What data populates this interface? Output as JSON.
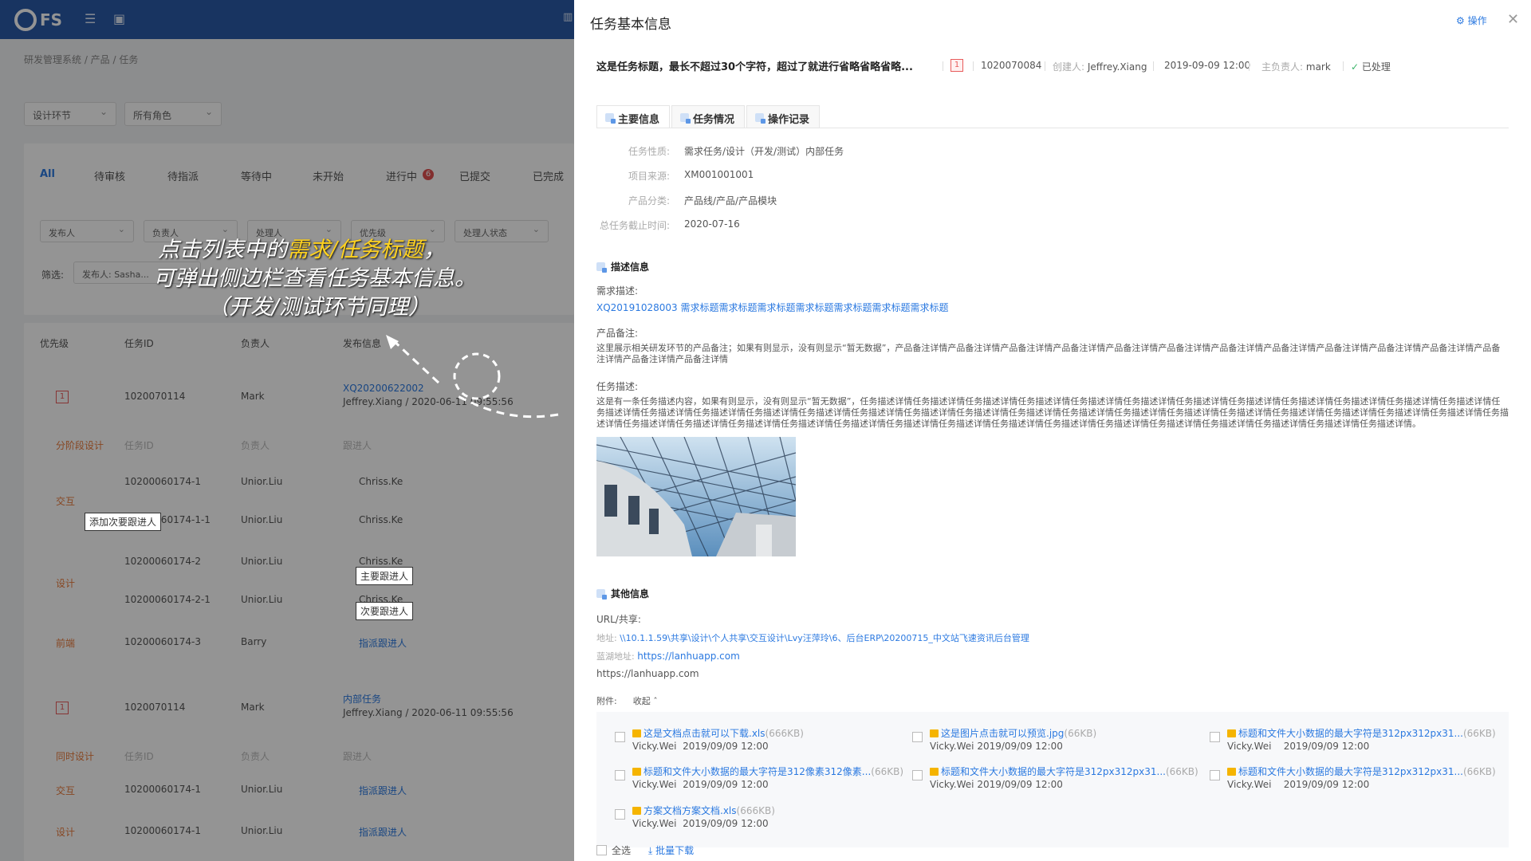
{
  "app": {
    "logo": "FS"
  },
  "breadcrumb": "研发管理系统 / 产品 / 任务",
  "filters": {
    "stage": "设计环节",
    "role": "所有角色"
  },
  "bg_tabs": [
    "All",
    "待审核",
    "待指派",
    "等待中",
    "未开始",
    "进行中",
    "已提交",
    "已完成"
  ],
  "bg_tab_badge": "6",
  "bg_selects": [
    "发布人",
    "负责人",
    "处理人",
    "优先级",
    "处理人状态"
  ],
  "bg_filter": {
    "label": "筛选:",
    "value": "发布人: Sasha..."
  },
  "bg_cols": [
    "优先级",
    "任务ID",
    "负责人",
    "发布信息"
  ],
  "bg_rows": [
    {
      "id": "1020070114",
      "owner": "Mark",
      "link": "XQ20200622002",
      "info": "Jeffrey.Xiang / 2020-06-11 09:55:56"
    },
    {
      "id": "1020070114",
      "owner": "Mark",
      "link": "内部任务",
      "info": "Jeffrey.Xiang / 2020-06-11 09:55:56"
    }
  ],
  "bg_sub1": [
    {
      "stage": "分阶段设计",
      "id": "任务ID",
      "owner": "负责人",
      "handler": "跟进人"
    },
    {
      "stage": "",
      "id": "10200060174-1",
      "owner": "Unior.Liu",
      "handler": "Chriss.Ke"
    },
    {
      "stage": "交互",
      "id": "10200060174-1-1",
      "owner": "Unior.Liu",
      "handler": "Chriss.Ke"
    },
    {
      "stage": "",
      "id": "10200060174-2",
      "owner": "Unior.Liu",
      "handler": "Chriss.Ke"
    },
    {
      "stage": "设计",
      "id": "10200060174-2-1",
      "owner": "Unior.Liu",
      "handler": "Chriss.Ke"
    },
    {
      "stage": "前端",
      "id": "10200060174-3",
      "owner": "Barry",
      "handler": "指派跟进人"
    }
  ],
  "bg_sub2": [
    {
      "stage": "同时设计",
      "id": "任务ID",
      "owner": "负责人",
      "handler": "跟进人"
    },
    {
      "stage": "交互",
      "id": "10200060174-1",
      "owner": "Unior.Liu",
      "handler": "指派跟进人"
    },
    {
      "stage": "设计",
      "id": "10200060174-1",
      "owner": "Unior.Liu",
      "handler": "指派跟进人"
    }
  ],
  "bg_priority": "1",
  "tooltips": {
    "add_secondary": "添加次要跟进人",
    "main_follow": "主要跟进人",
    "secondary_follow": "次要跟进人"
  },
  "annotation": {
    "line1_pre": "点击列表中的",
    "line1_hl": "需求/任务标题",
    "line1_post": "，",
    "line2": "可弹出侧边栏查看任务基本信息。",
    "line3": "（开发/测试环节同理）"
  },
  "panel": {
    "title": "任务基本信息",
    "op_label": "操作",
    "headline": "这是任务标题，最长不超过30个字符，超过了就进行省略省略省略...",
    "priority": "1",
    "task_id": "1020070084",
    "creator_label": "创建人:",
    "creator": "Jeffrey.Xiang",
    "created": "2019-09-09 12:00",
    "owner_label": "主负责人:",
    "owner": "mark",
    "status": "已处理",
    "tabs": [
      "主要信息",
      "任务情况",
      "操作记录"
    ],
    "fields": [
      {
        "label": "任务性质:",
        "value": "需求任务/设计（开发/测试）内部任务"
      },
      {
        "label": "项目来源:",
        "value": "XM001001001"
      },
      {
        "label": "产品分类:",
        "value": "产品线/产品/产品模块"
      },
      {
        "label": "总任务截止时间:",
        "value": "2020-07-16"
      }
    ],
    "desc_title": "描述信息",
    "req_label": "需求描述:",
    "req_link": "XQ20191028003 需求标题需求标题需求标题需求标题需求标题需求标题需求标题",
    "prod_label": "产品备注:",
    "prod_text": "这里展示相关研发环节的产品备注；如果有则显示，没有则显示“暂无数据”，产品备注详情产品备注详情产品备注详情产品备注详情产品备注详情产品备注详情产品备注详情产品备注详情产品备注详情产品备注详情产品备注详情产品备注详情产品备注详情产品备注详情",
    "task_label": "任务描述:",
    "task_text": "这是有一条任务描述内容，如果有则显示，没有则显示“暂无数据”，任务描述详情任务描述详情任务描述详情任务描述详情任务描述详情任务描述详情任务描述详情任务描述详情任务描述详情任务描述详情任务描述详情任务描述详情任务描述详情任务描述详情任务描述详情任务描述详情任务描述详情任务描述详情任务描述详情任务描述详情任务描述详情任务描述详情任务描述详情任务描述详情任务描述详情任务描述详情任务描述详情任务描述详情任务描述详情任务描述详情任务描述详情任务描述详情任务描述详情任务描述详情任务描述详情任务描述详情任务描述详情任务描述详情任务描述详情任务描述详情任务描述详情任务描述详情任务描述详情任务描述详情任务描述详情。",
    "other_title": "其他信息",
    "url_label": "URL/共享:",
    "addr_label": "地址:",
    "addr": "\\\\10.1.1.59\\共享\\设计\\个人共享\\交互设计\\Lvy汪萍玲\\6、后台ERP\\20200715_中文站飞速资讯后台管理",
    "lanhu_label": "蓝湖地址:",
    "lanhu": "https://lanhuapp.com",
    "url2": "https://lanhuapp.com",
    "att_label": "附件:",
    "collapse": "收起",
    "attachments": [
      {
        "name": "这是文档点击就可以下载.xls",
        "size": "(666KB)",
        "user": "Vicky.Wei",
        "date": "2019/09/09 12:00"
      },
      {
        "name": "这是图片点击就可以预览.jpg",
        "size": "(66KB)",
        "user": "Vicky.Wei",
        "date": "2019/09/09 12:00"
      },
      {
        "name": "标题和文件大小数据的最大字符是312px312px31...",
        "size": "(66KB)",
        "user": "Vicky.Wei",
        "date": "2019/09/09 12:00"
      },
      {
        "name": "标题和文件大小数据的最大字符是312像素312像素...",
        "size": "(66KB)",
        "user": "Vicky.Wei",
        "date": "2019/09/09 12:00"
      },
      {
        "name": "标题和文件大小数据的最大字符是312px312px31...",
        "size": "(66KB)",
        "user": "Vicky.Wei",
        "date": "2019/09/09 12:00"
      },
      {
        "name": "标题和文件大小数据的最大字符是312px312px31...",
        "size": "(66KB)",
        "user": "Vicky.Wei",
        "date": "2019/09/09 12:00"
      },
      {
        "name": "方案文档方案文档.xls",
        "size": "(666KB)",
        "user": "Vicky.Wei",
        "date": "2019/09/09 12:00"
      }
    ],
    "select_all": "全选",
    "batch_download": "批量下载"
  }
}
